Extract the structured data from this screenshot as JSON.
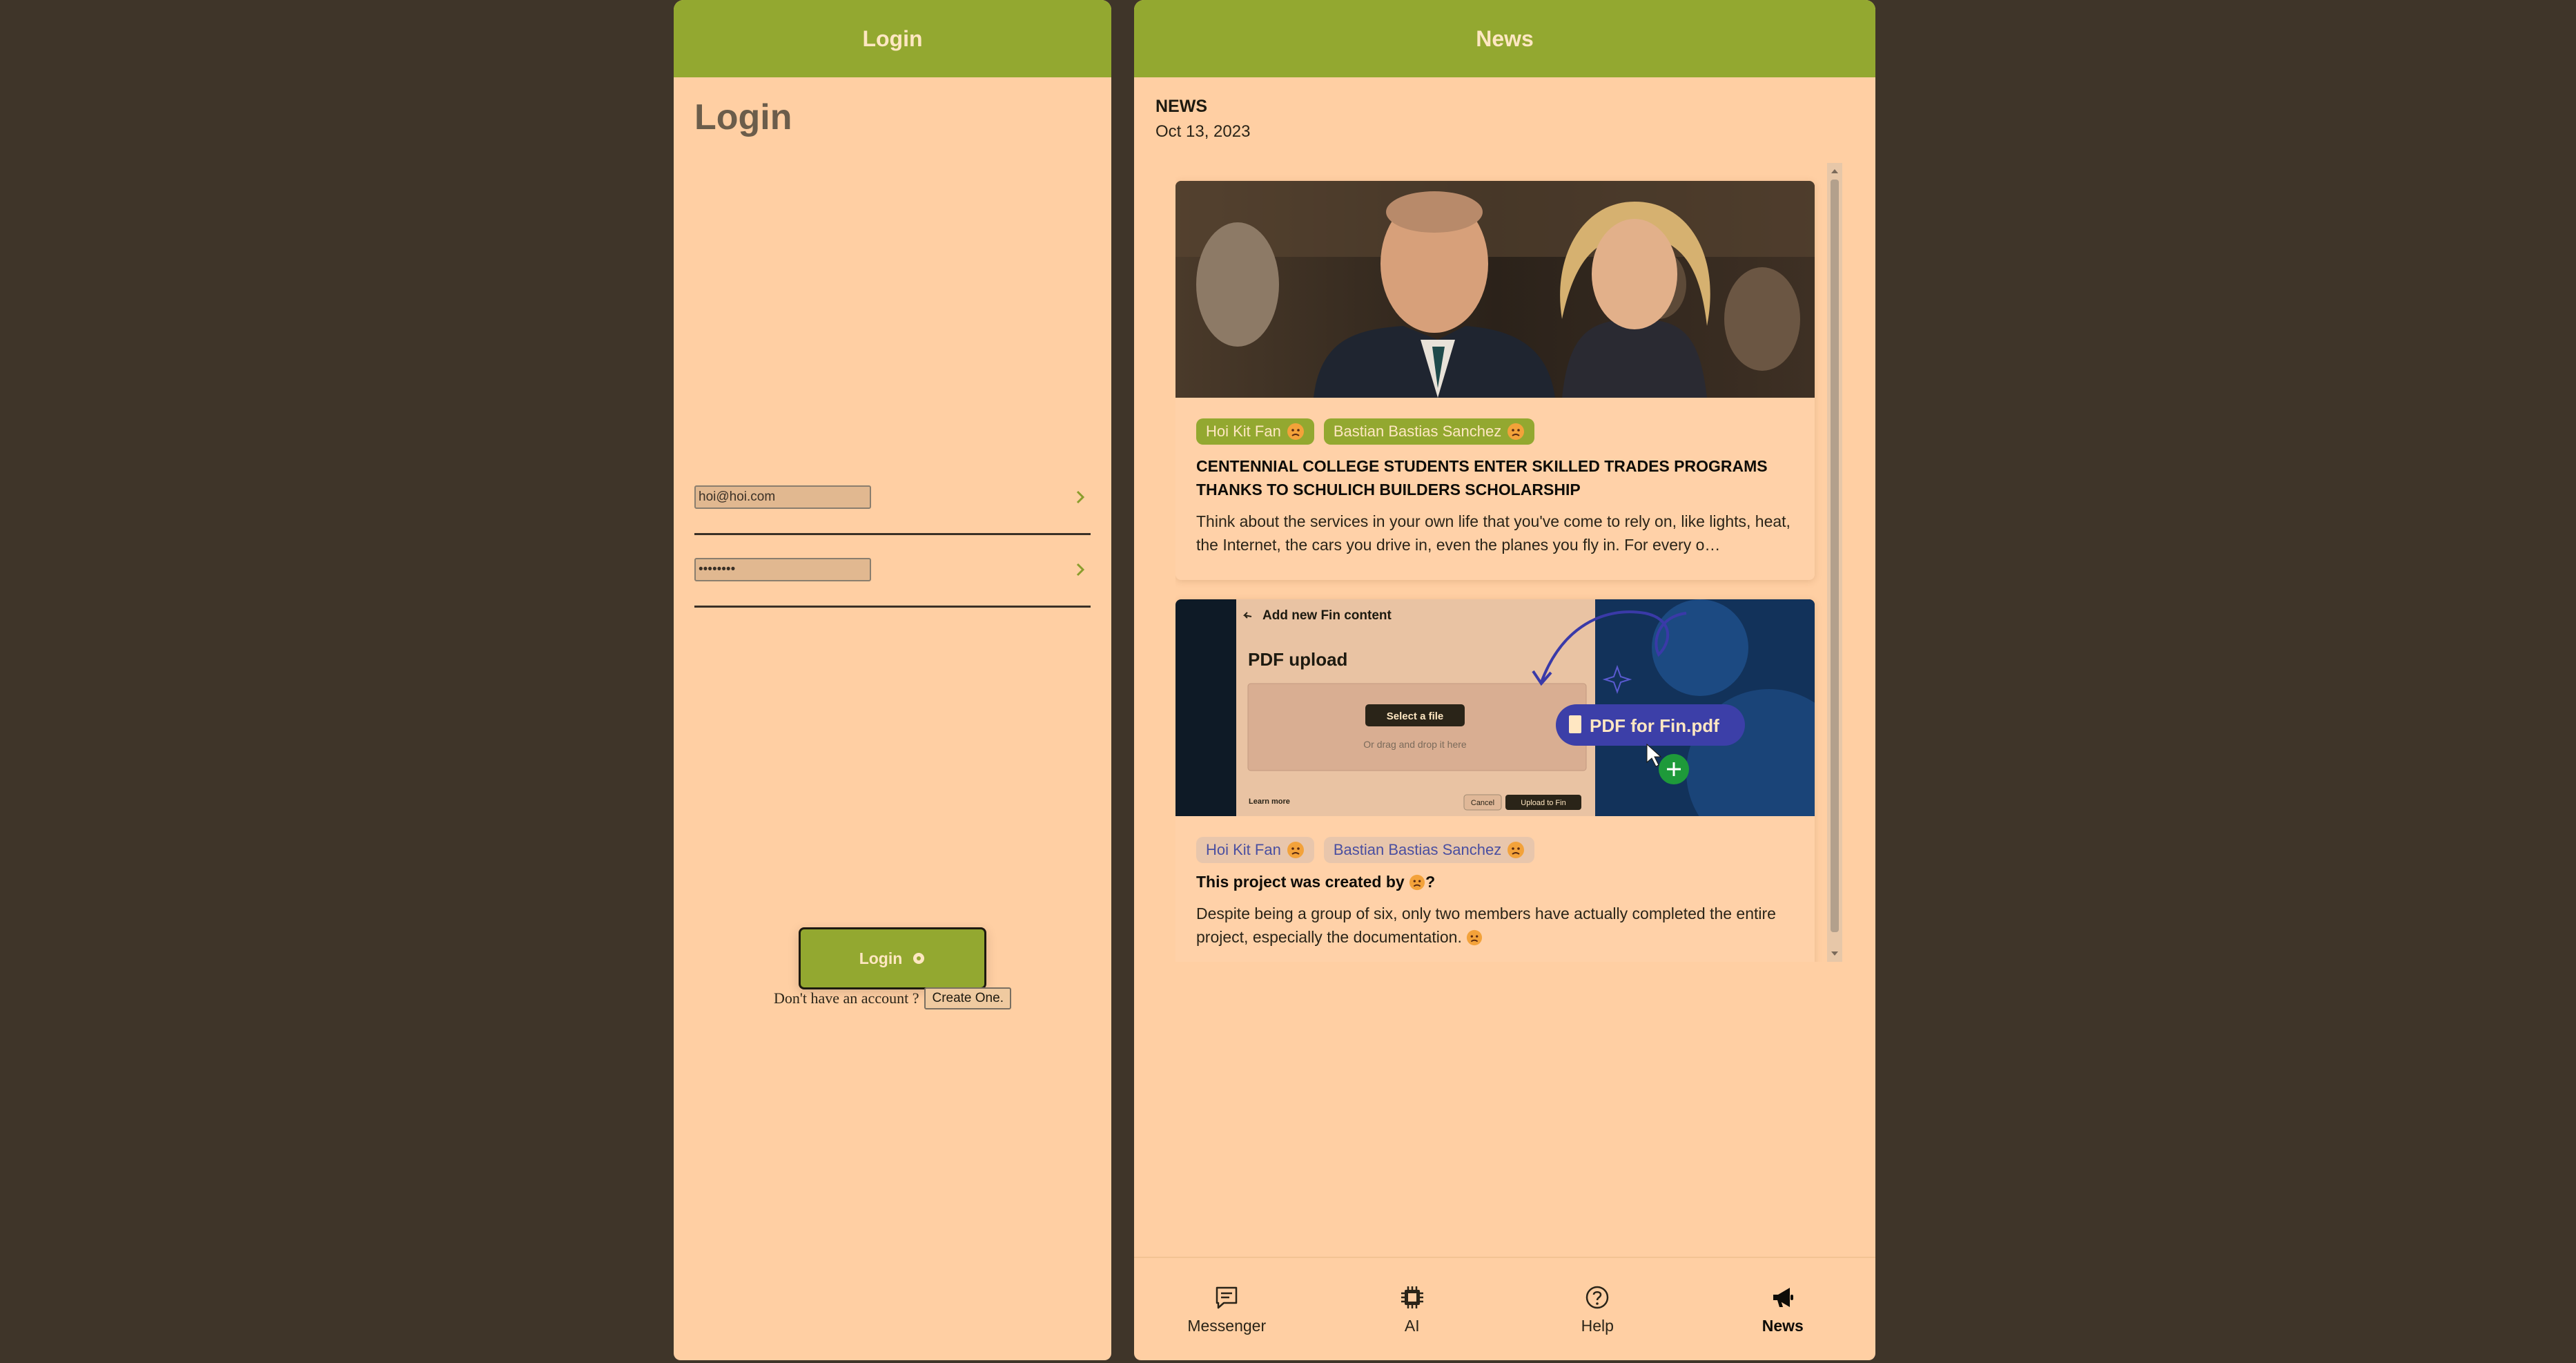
{
  "login_panel": {
    "header": "Login",
    "title": "Login",
    "email_value": "hoi@hoi.com",
    "password_value": "••••••••",
    "login_button": "Login",
    "no_account_text": "Don't have an account ?",
    "create_button": "Create One."
  },
  "news_panel": {
    "header": "News",
    "section_label": "NEWS",
    "date": "Oct 13, 2023",
    "cards": [
      {
        "tags": [
          "Hoi Kit Fan",
          "Bastian Bastias Sanchez"
        ],
        "title": "CENTENNIAL COLLEGE STUDENTS ENTER SKILLED TRADES PROGRAMS THANKS TO SCHULICH BUILDERS SCHOLARSHIP",
        "body": "Think about the services in your own life that you've come to rely on, like lights, heat, the Internet, the cars you drive in, even the planes you fly in. For every o…"
      },
      {
        "tags": [
          "Hoi Kit Fan",
          "Bastian Bastias Sanchez"
        ],
        "title": "This project was created by",
        "title_suffix": "?",
        "body": "Despite being a group of six, only two members have actually completed the entire project, especially the documentation.",
        "image": {
          "back_label": "Add new Fin content",
          "heading": "PDF upload",
          "select_button": "Select a file",
          "drop_hint": "Or drag and drop it here",
          "learn_more": "Learn more",
          "cancel": "Cancel",
          "upload": "Upload to Fin",
          "file_chip": "PDF for Fin.pdf"
        }
      }
    ]
  },
  "bottom_nav": {
    "items": [
      {
        "label": "Messenger",
        "icon": "chat-icon"
      },
      {
        "label": "AI",
        "icon": "chip-icon"
      },
      {
        "label": "Help",
        "icon": "help-icon"
      },
      {
        "label": "News",
        "icon": "megaphone-icon",
        "active": true
      }
    ]
  },
  "colors": {
    "background": "#3f3529",
    "panel": "#ffcfa3",
    "accent": "#93a830",
    "header_text": "#ffe7c2"
  }
}
